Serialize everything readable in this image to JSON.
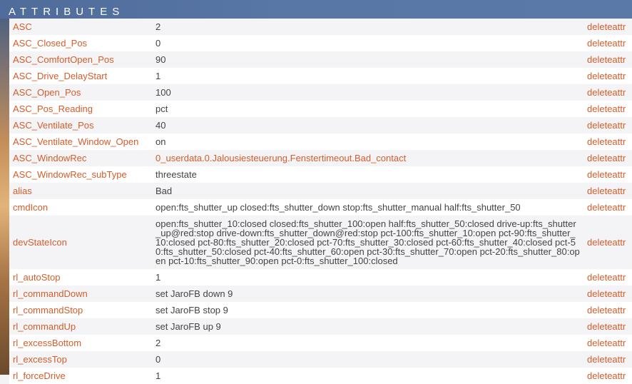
{
  "header": {
    "title": "ATTRIBUTES"
  },
  "rows": [
    {
      "name": "ASC",
      "value": "2",
      "action": "deleteattr"
    },
    {
      "name": "ASC_Closed_Pos",
      "value": "0",
      "action": "deleteattr"
    },
    {
      "name": "ASC_ComfortOpen_Pos",
      "value": "90",
      "action": "deleteattr"
    },
    {
      "name": "ASC_Drive_DelayStart",
      "value": "1",
      "action": "deleteattr"
    },
    {
      "name": "ASC_Open_Pos",
      "value": "100",
      "action": "deleteattr"
    },
    {
      "name": "ASC_Pos_Reading",
      "value": "pct",
      "action": "deleteattr"
    },
    {
      "name": "ASC_Ventilate_Pos",
      "value": "40",
      "action": "deleteattr"
    },
    {
      "name": "ASC_Ventilate_Window_Open",
      "value": "on",
      "action": "deleteattr"
    },
    {
      "name": "ASC_WindowRec",
      "value": "0_userdata.0.Jalousiesteuerung.Fenstertimeout.Bad_contact",
      "action": "deleteattr"
    },
    {
      "name": "ASC_WindowRec_subType",
      "value": "threestate",
      "action": "deleteattr"
    },
    {
      "name": "alias",
      "value": "Bad",
      "action": "deleteattr"
    },
    {
      "name": "cmdIcon",
      "value": "open:fts_shutter_up closed:fts_shutter_down stop:fts_shutter_manual half:fts_shutter_50",
      "action": "deleteattr"
    },
    {
      "name": "devStateIcon",
      "value": "open:fts_shutter_10:closed closed:fts_shutter_100:open half:fts_shutter_50:closed drive-up:fts_shutter_up@red:stop drive-down:fts_shutter_down@red:stop pct-100:fts_shutter_10:open pct-90:fts_shutter_10:closed pct-80:fts_shutter_20:closed pct-70:fts_shutter_30:closed pct-60:fts_shutter_40:closed pct-50:fts_shutter_50:closed pct-40:fts_shutter_60:open pct-30:fts_shutter_70:open pct-20:fts_shutter_80:open pct-10:fts_shutter_90:open pct-0:fts_shutter_100:closed",
      "action": "deleteattr"
    },
    {
      "name": "rl_autoStop",
      "value": "1",
      "action": "deleteattr"
    },
    {
      "name": "rl_commandDown",
      "value": "set JaroFB down 9",
      "action": "deleteattr"
    },
    {
      "name": "rl_commandStop",
      "value": "set JaroFB stop 9",
      "action": "deleteattr"
    },
    {
      "name": "rl_commandUp",
      "value": "set JaroFB up 9",
      "action": "deleteattr"
    },
    {
      "name": "rl_excessBottom",
      "value": "2",
      "action": "deleteattr"
    },
    {
      "name": "rl_excessTop",
      "value": "0",
      "action": "deleteattr"
    },
    {
      "name": "rl_forceDrive",
      "value": "1",
      "action": "deleteattr"
    }
  ],
  "colors": {
    "link": "#d45d2a",
    "text": "#444444",
    "header": "#5876a6"
  }
}
